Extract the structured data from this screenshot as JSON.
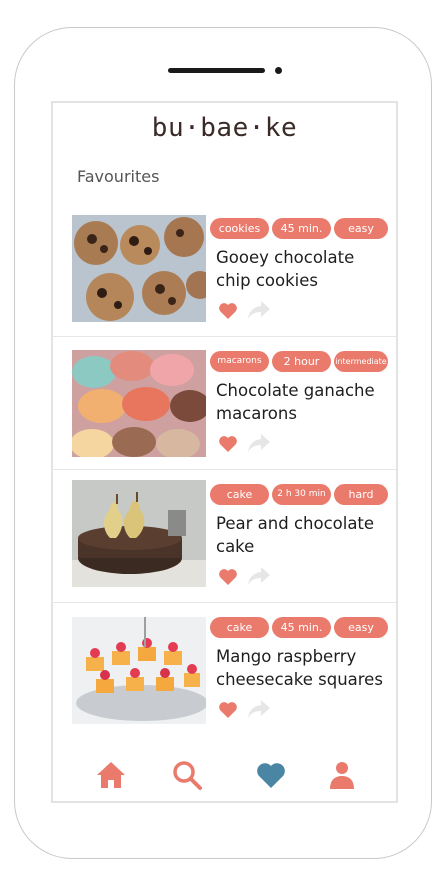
{
  "app": {
    "logo": "bu·bae·ke"
  },
  "section": {
    "title": "Favourites"
  },
  "colors": {
    "accent": "#ea7b6c",
    "active_nav": "#4a86a3",
    "share_inactive": "#e6e6e6"
  },
  "recipes": [
    {
      "title": "Gooey chocolate chip cookies",
      "tags": [
        "cookies",
        "45 min.",
        "easy"
      ],
      "image": "cookies-photo"
    },
    {
      "title": "Chocolate ganache macarons",
      "tags": [
        "macarons",
        "2 hour",
        "intermediate"
      ],
      "image": "macarons-photo"
    },
    {
      "title": "Pear and chocolate cake",
      "tags": [
        "cake",
        "2 h 30 min",
        "hard"
      ],
      "image": "pear-cake-photo"
    },
    {
      "title": "Mango raspberry cheesecake squares",
      "tags": [
        "cake",
        "45 min.",
        "easy"
      ],
      "image": "cheesecake-photo"
    }
  ],
  "nav": [
    {
      "name": "home",
      "icon": "home-icon",
      "active": false
    },
    {
      "name": "search",
      "icon": "search-icon",
      "active": false
    },
    {
      "name": "favourites",
      "icon": "heart-icon",
      "active": true
    },
    {
      "name": "profile",
      "icon": "user-icon",
      "active": false
    }
  ]
}
